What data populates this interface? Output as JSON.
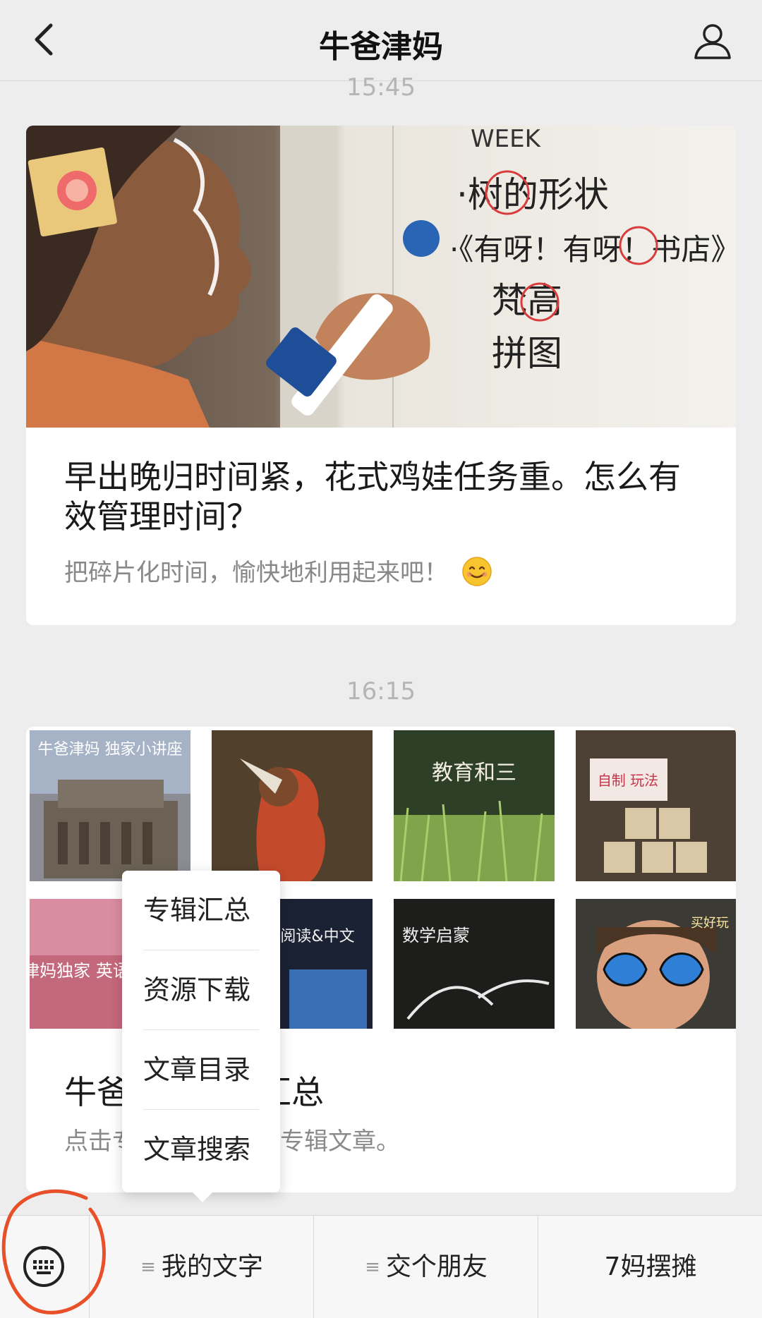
{
  "header": {
    "title": "牛爸津妈"
  },
  "timestamps": {
    "first": "15:45",
    "second": "16:15"
  },
  "article1": {
    "title": "早出晚归时间紧，花式鸡娃任务重。怎么有效管理时间？",
    "digest": "把碎片化时间，愉快地利用起来吧！",
    "cover_text": {
      "week": "WEEK",
      "line1": "·树的形状",
      "line2": "·《有呀！有呀！书店》",
      "line3": "梵高",
      "line4": "拼图"
    }
  },
  "article2": {
    "title": "牛爸津妈专辑汇总",
    "digest": "点击专辑封面，阅读专辑文章。",
    "thumbs": [
      {
        "text": "牛爸津妈 独家小讲座"
      },
      {
        "text": ""
      },
      {
        "text": "教育和三"
      },
      {
        "text": "自制 玩法"
      },
      {
        "text": "津妈独家 英语启蒙"
      },
      {
        "text": "阅读&中文"
      },
      {
        "text": "数学启蒙"
      },
      {
        "text": "买好玩"
      }
    ]
  },
  "popup": {
    "items": [
      "专辑汇总",
      "资源下载",
      "文章目录",
      "文章搜索"
    ]
  },
  "menubar": {
    "items": [
      "我的文字",
      "交个朋友",
      "7妈摆摊"
    ]
  },
  "colors": {
    "background": "#ededed",
    "annotation": "#e8502a"
  }
}
